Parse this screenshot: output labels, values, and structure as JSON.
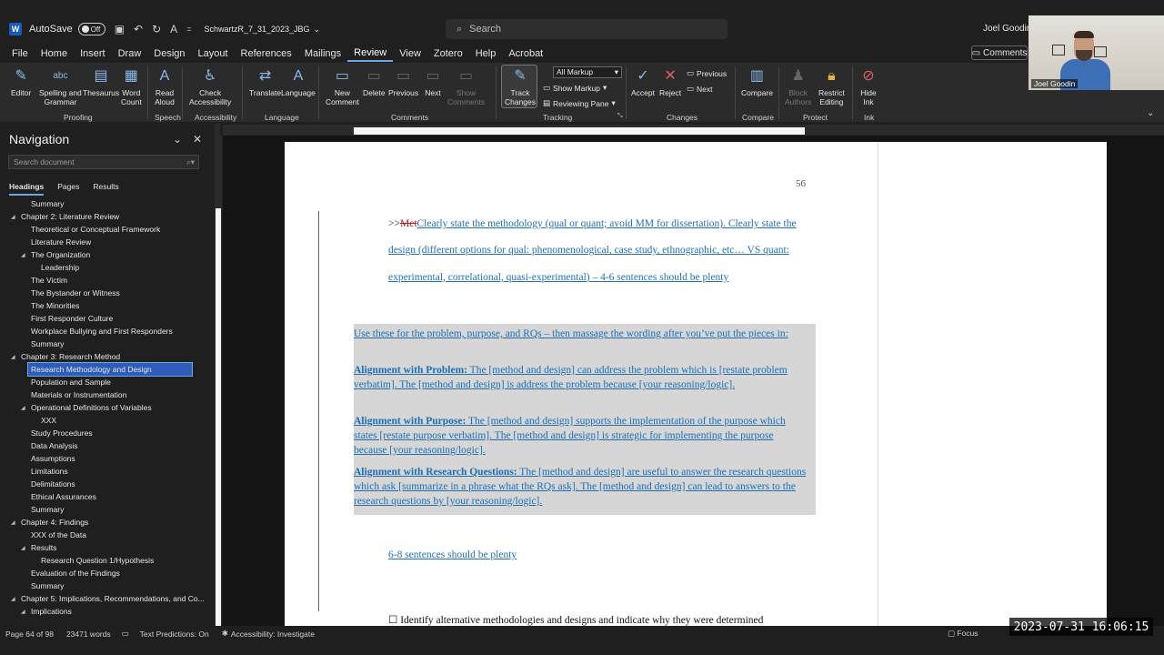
{
  "titlebar": {
    "autosave_label": "AutoSave",
    "autosave_state": "Off",
    "doc_title": "SchwartzR_7_31_2023_JBG",
    "search_placeholder": "Search",
    "user_name": "Joel Goodin"
  },
  "menu": {
    "items": [
      "File",
      "Home",
      "Insert",
      "Draw",
      "Design",
      "Layout",
      "References",
      "Mailings",
      "Review",
      "View",
      "Zotero",
      "Help",
      "Acrobat"
    ],
    "active": "Review",
    "comments_button": "Comments"
  },
  "ribbon": {
    "proofing": {
      "editor": "Editor",
      "spelling": "Spelling and",
      "spelling2": "Grammar",
      "thesaurus": "Thesaurus",
      "wordcount": "Word",
      "wordcount2": "Count",
      "label": "Proofing"
    },
    "speech": {
      "read": "Read",
      "read2": "Aloud",
      "label": "Speech"
    },
    "accessibility": {
      "check": "Check",
      "check2": "Accessibility",
      "label": "Accessibility"
    },
    "language": {
      "translate": "Translate",
      "language": "Language",
      "label": "Language"
    },
    "comments": {
      "new": "New",
      "new2": "Comment",
      "delete": "Delete",
      "previous": "Previous",
      "next": "Next",
      "show": "Show",
      "show2": "Comments",
      "label": "Comments"
    },
    "tracking": {
      "track": "Track",
      "track2": "Changes",
      "markup_select": "All Markup",
      "show_markup": "Show Markup",
      "reviewing_pane": "Reviewing Pane",
      "label": "Tracking"
    },
    "changes": {
      "accept": "Accept",
      "reject": "Reject",
      "previous": "Previous",
      "next": "Next",
      "label": "Changes"
    },
    "compare": {
      "compare": "Compare",
      "label": "Compare"
    },
    "protect": {
      "block": "Block",
      "block2": "Authors",
      "restrict": "Restrict",
      "restrict2": "Editing",
      "label": "Protect"
    },
    "ink": {
      "hide": "Hide",
      "hide2": "Ink",
      "label": "Ink"
    }
  },
  "video": {
    "name": "Joel Goodin"
  },
  "navigation": {
    "title": "Navigation",
    "search_placeholder": "Search document",
    "tabs": [
      "Headings",
      "Pages",
      "Results"
    ],
    "items": [
      {
        "label": "Summary",
        "level": 2
      },
      {
        "label": "Chapter 2: Literature Review",
        "level": 1,
        "caret": true
      },
      {
        "label": "Theoretical or Conceptual Framework",
        "level": 2
      },
      {
        "label": "Literature Review",
        "level": 2
      },
      {
        "label": "The Organization",
        "level": 2,
        "caret": true
      },
      {
        "label": "Leadership",
        "level": 3
      },
      {
        "label": "The Victim",
        "level": 2
      },
      {
        "label": "The Bystander or Witness",
        "level": 2
      },
      {
        "label": "The Minorities",
        "level": 2
      },
      {
        "label": "First Responder Culture",
        "level": 2
      },
      {
        "label": "Workplace Bullying and First Responders",
        "level": 2
      },
      {
        "label": "Summary",
        "level": 2
      },
      {
        "label": "Chapter 3: Research Method",
        "level": 1,
        "caret": true
      },
      {
        "label": "Research Methodology and Design",
        "level": 2,
        "selected": true
      },
      {
        "label": "Population and Sample",
        "level": 2
      },
      {
        "label": "Materials or Instrumentation",
        "level": 2
      },
      {
        "label": "Operational Definitions of Variables",
        "level": 2,
        "caret": true
      },
      {
        "label": "XXX",
        "level": 3
      },
      {
        "label": "Study Procedures",
        "level": 2
      },
      {
        "label": "Data Analysis",
        "level": 2
      },
      {
        "label": "Assumptions",
        "level": 2
      },
      {
        "label": "Limitations",
        "level": 2
      },
      {
        "label": "Delimitations",
        "level": 2
      },
      {
        "label": "Ethical Assurances",
        "level": 2
      },
      {
        "label": "Summary",
        "level": 2
      },
      {
        "label": "Chapter 4: Findings",
        "level": 1,
        "caret": true
      },
      {
        "label": "XXX of the Data",
        "level": 2
      },
      {
        "label": "Results",
        "level": 2,
        "caret": true
      },
      {
        "label": "Research Question 1/Hypothesis",
        "level": 3
      },
      {
        "label": "Evaluation of the Findings",
        "level": 2
      },
      {
        "label": "Summary",
        "level": 2
      },
      {
        "label": "Chapter 5: Implications, Recommendations, and Co...",
        "level": 1,
        "caret": true
      },
      {
        "label": "Implications",
        "level": 2,
        "caret": true
      }
    ]
  },
  "document": {
    "page_number": "56",
    "para1_prefix": ">>",
    "para1_deleted": "Met",
    "para1_inserted": "Clearly state the methodology (qual or quant; avoid MM for dissertation). Clearly state the design (different options for qual: phenomenological, case study, ethnographic, etc… VS quant: experimental, correlational, quasi-experimental) – 4-6 sentences should be plenty",
    "hl1": "Use these for the problem, purpose, and RQs – then massage the wording after you’ve put the pieces in:",
    "hl2_bold": "Alignment with Problem:",
    "hl2_text": " The [method and design] can address the problem which is [restate problem verbatim]. The [method and design] is address the problem because [your reasoning/logic].",
    "hl3_bold": "Alignment with Purpose:",
    "hl3_text": " The [method and design] supports the implementation of the purpose which states [restate purpose verbatim]. The [method and design] is strategic for implementing the purpose because [your reasoning/logic].",
    "hl4_bold": "Alignment with Research Questions:",
    "hl4_text": " The [method and design] are useful to answer the research questions which ask [summarize in a phrase what the RQs ask]. The [method and design] can lead to answers to the research questions by [your reasoning/logic].",
    "para_end": "6-8 sentences should be plenty",
    "para_last": "Identify alternative methodologies and designs and indicate why they were determined"
  },
  "status": {
    "page": "Page 64 of 98",
    "words": "23471 words",
    "text_predictions": "Text Predictions: On",
    "accessibility": "Accessibility: Investigate",
    "focus": "Focus",
    "timestamp": "2023-07-31 16:06:15"
  }
}
